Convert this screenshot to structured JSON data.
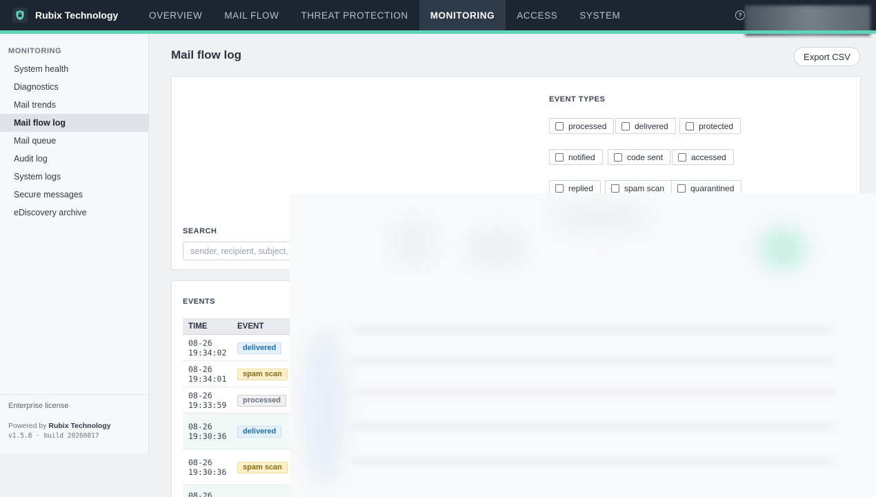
{
  "brand": {
    "name": "Rubix Technology"
  },
  "nav": [
    {
      "label": "OVERVIEW",
      "active": false
    },
    {
      "label": "MAIL FLOW",
      "active": false
    },
    {
      "label": "THREAT PROTECTION",
      "active": false
    },
    {
      "label": "MONITORING",
      "active": true
    },
    {
      "label": "ACCESS",
      "active": false
    },
    {
      "label": "SYSTEM",
      "active": false
    }
  ],
  "sidebar": {
    "heading": "MONITORING",
    "items": [
      {
        "label": "System health"
      },
      {
        "label": "Diagnostics"
      },
      {
        "label": "Mail trends"
      },
      {
        "label": "Mail flow log"
      },
      {
        "label": "Mail queue"
      },
      {
        "label": "Audit log"
      },
      {
        "label": "System logs"
      },
      {
        "label": "Secure messages"
      },
      {
        "label": "eDiscovery archive"
      }
    ],
    "active_index": 3,
    "footer": {
      "license": "Enterprise license",
      "powered_prefix": "Powered by",
      "powered_brand": "Rubix Technology",
      "version": "v1.5.8 · build 20260817"
    }
  },
  "page": {
    "title": "Mail flow log",
    "export_label": "Export CSV"
  },
  "filters": {
    "event_types_label": "EVENT TYPES",
    "chips": [
      [
        "processed",
        "delivered",
        "protected"
      ],
      [
        "notified",
        "code sent",
        "accessed"
      ],
      [
        "replied",
        "spam scan",
        "quarantined"
      ]
    ],
    "search_label": "SEARCH",
    "search_placeholder": "sender, recipient, subject, l"
  },
  "events": {
    "label": "EVENTS",
    "columns": {
      "time": "TIME",
      "event": "EVENT"
    },
    "rows": [
      {
        "date": "08-26",
        "time": "19:34:02",
        "event": "delivered",
        "kind": "delivered"
      },
      {
        "date": "08-26",
        "time": "19:34:01",
        "event": "spam scan",
        "kind": "spam"
      },
      {
        "date": "08-26",
        "time": "19:33:59",
        "event": "processed",
        "kind": "processed"
      },
      {
        "date": "08-26",
        "time": "19:30:36",
        "event": "delivered",
        "kind": "delivered"
      },
      {
        "date": "08-26",
        "time": "19:30:36",
        "event": "spam scan",
        "kind": "spam"
      },
      {
        "date": "08-26",
        "time": "",
        "event": "",
        "kind": ""
      }
    ]
  },
  "colors": {
    "topbar": "#1d2530",
    "accent": "#5fd3b8",
    "sidebar_active": "#dfe2e6"
  }
}
